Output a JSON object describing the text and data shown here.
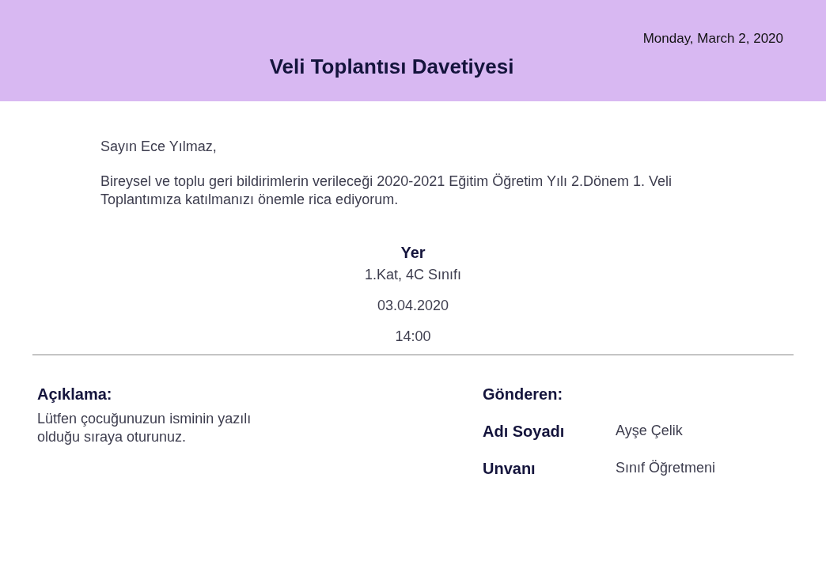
{
  "header": {
    "date": "Monday, March 2, 2020",
    "title": "Veli Toplantısı Davetiyesi"
  },
  "greeting": "Sayın Ece Yılmaz,",
  "message": "Bireysel ve toplu geri bildirimlerin verileceği 2020-2021 Eğitim Öğretim Yılı 2.Dönem 1. Veli Toplantımıza katılmanızı önemle rica ediyorum.",
  "location": {
    "heading": "Yer",
    "place": "1.Kat, 4C Sınıfı",
    "date": "03.04.2020",
    "time": "14:00"
  },
  "note": {
    "heading": "Açıklama:",
    "text": "Lütfen çocuğunuzun isminin yazılı olduğu sıraya oturunuz."
  },
  "sender": {
    "heading": "Gönderen:",
    "fields": [
      {
        "label": "Adı Soyadı",
        "value": "Ayşe Çelik"
      },
      {
        "label": "Unvanı",
        "value": "Sınıf Öğretmeni"
      }
    ]
  }
}
